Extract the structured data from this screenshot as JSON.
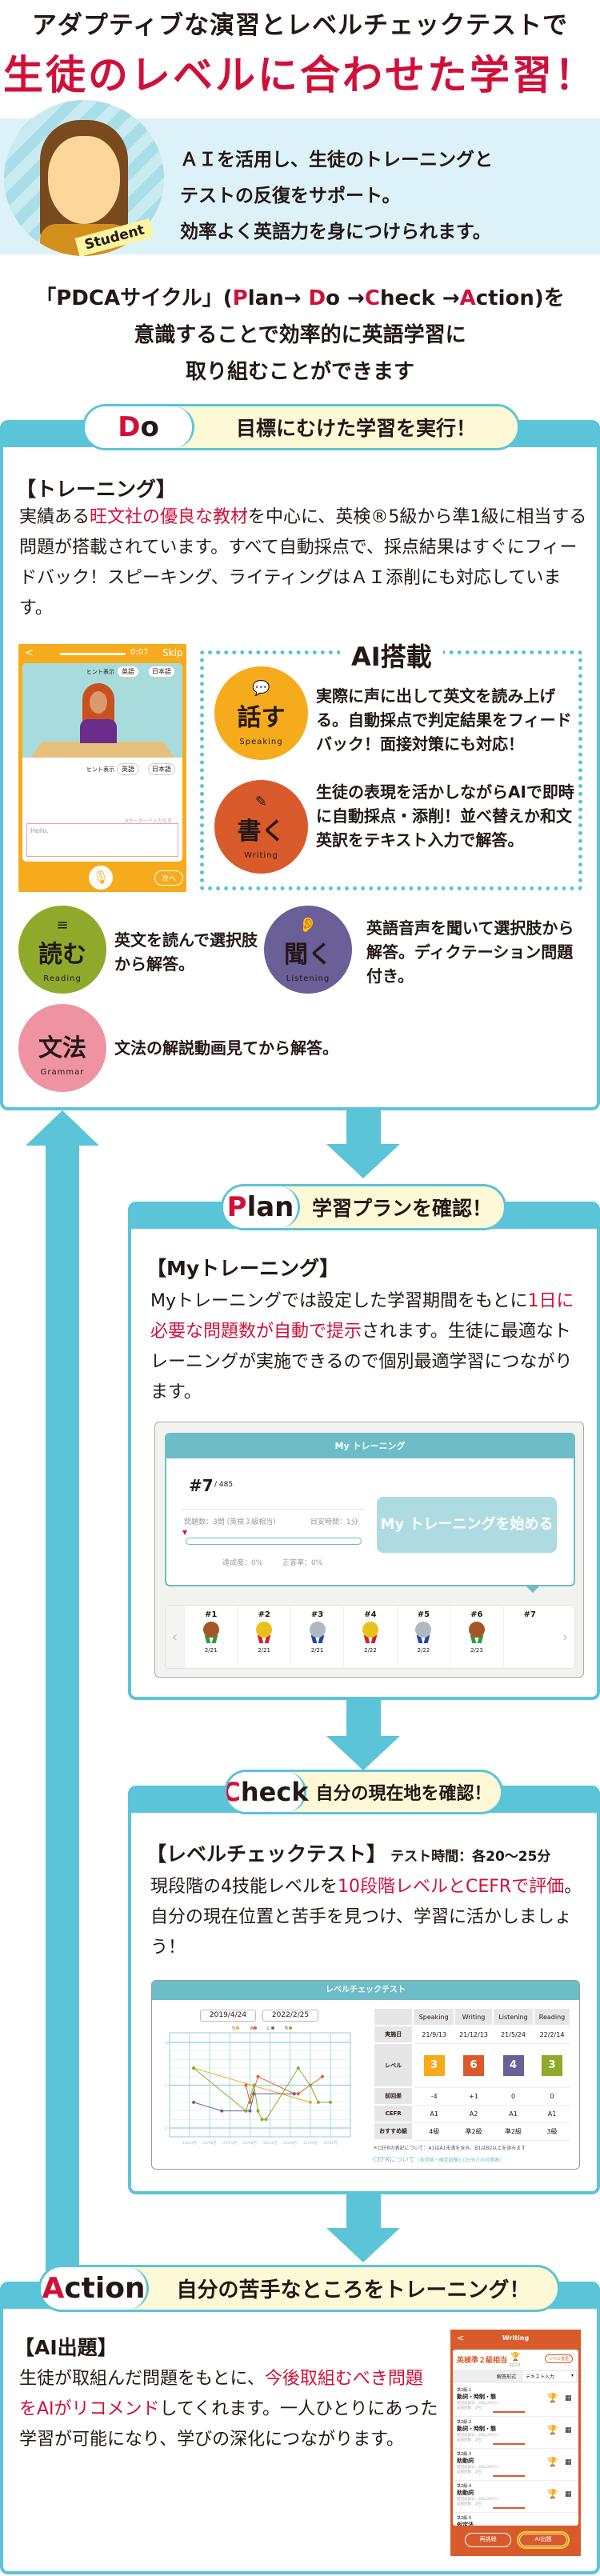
{
  "headline": {
    "line1": "アダプティブな演習とレベルチェックテストで",
    "line2": "生徒のレベルに合わせた学習！"
  },
  "intro": {
    "badge": "Student",
    "lines": [
      "ＡＩを活用し、生徒のトレーニングと",
      "テストの反復をサポート。",
      "効率よく英語力を身につけられます。"
    ]
  },
  "pdca": {
    "open": "「PDCAサイクル」(",
    "p1": "P",
    "p2": "lan→ ",
    "d1": "D",
    "d2": "o →",
    "c1": "C",
    "c2": "heck →",
    "a1": "A",
    "a2": "ction)を",
    "line2": "意識することで効率的に英語学習に",
    "line3": "取り組むことができます"
  },
  "colors": {
    "teal": "#5bc4d8",
    "red": "#d0103a",
    "speaking": "#f5ab1c",
    "writing": "#d95a2b",
    "reading": "#8fa92a",
    "listening": "#6a5f97",
    "grammar": "#ef93a3"
  },
  "do": {
    "key_first": "D",
    "key_rest": "o",
    "title": "目標にむけた学習を実行！",
    "heading": "【トレーニング】",
    "body_a": "実績ある",
    "body_red": "旺文社の優良な教材",
    "body_b": "を中心に、英検®5級から準1級に相当する問題が搭載されています。すべて自動採点で、採点結果はすぐにフィードバック！スピーキング、ライティングはＡＩ添削にも対応しています。",
    "phone": {
      "back": "<",
      "time": "0:07",
      "skip": "Skip",
      "hint": "ヒント表示",
      "en": "英語",
      "ja": "日本語",
      "keyboard_note": "※キーボード入力も可",
      "input": "Hello.",
      "next": "次へ"
    },
    "ai_label": "AI搭載",
    "skills": [
      {
        "name": "話す",
        "en": "Speaking",
        "icon": "speech-bubble-icon",
        "desc": "実際に声に出して英文を読み上げる。自動採点で判定結果をフィードバック！面接対策にも対応！"
      },
      {
        "name": "書く",
        "en": "Writing",
        "icon": "pencil-icon",
        "desc": "生徒の表現を活かしながらAIで即時に自動採点・添削！並べ替えか和文英訳をテキスト入力で解答。"
      },
      {
        "name": "読む",
        "en": "Reading",
        "icon": "text-lines-icon",
        "desc": "英文を読んで選択肢から解答。"
      },
      {
        "name": "聞く",
        "en": "Listening",
        "icon": "ear-icon",
        "desc": "英語音声を聞いて選択肢から解答。ディクテーション問題付き。"
      },
      {
        "name": "文法",
        "en": "Grammar",
        "icon": "",
        "desc": "文法の解説動画見てから解答。"
      }
    ]
  },
  "plan": {
    "key_first": "P",
    "key_rest": "lan",
    "title": "学習プランを確認！",
    "heading": "【Myトレーニング】",
    "body_a": "Myトレーニングでは設定した学習期間をもとに",
    "body_red": "1日に必要な問題数が自動で提示",
    "body_b": "されます。生徒に最適なトレーニングが実施できるので個別最適学習につながります。",
    "mock": {
      "header": "My トレーニング",
      "current": "#7",
      "total": "/ 485",
      "questions": "問題数：3問 (英検３級相当)",
      "time": "目安時間：1分",
      "progress_percent": 0,
      "achievement": "達成度：0%",
      "accuracy": "正答率：0%",
      "start_button": "My トレーニングを始める",
      "sessions": [
        {
          "num": "#1",
          "medal": "bronze",
          "date": "2/21"
        },
        {
          "num": "#2",
          "medal": "gold",
          "date": "2/21"
        },
        {
          "num": "#3",
          "medal": "silver",
          "date": "2/21"
        },
        {
          "num": "#4",
          "medal": "gold",
          "date": "2/22"
        },
        {
          "num": "#5",
          "medal": "silver",
          "date": "2/22"
        },
        {
          "num": "#6",
          "medal": "bronze",
          "date": "2/23"
        },
        {
          "num": "#7",
          "medal": "",
          "date": ""
        }
      ]
    }
  },
  "check": {
    "key_first": "C",
    "key_rest": "heck",
    "title": "自分の現在地を確認！",
    "heading": "【レベルチェックテスト】",
    "subheading": "テスト時間：各20～25分",
    "body_a": "現段階の4技能レベルを",
    "body_red": "10段階レベルとCEFRで評価",
    "body_b": "。自分の現在位置と苦手を見つけ、学習に活かしましょう！",
    "mock": {
      "header": "レベルチェックテスト",
      "date_from": "2019/4/24",
      "date_to": "2022/2/25",
      "table": {
        "columns": [
          "",
          "Speaking",
          "Writing",
          "Listening",
          "Reading"
        ],
        "rows": [
          {
            "label": "実施日",
            "values": [
              "21/9/13",
              "21/12/13",
              "21/5/24",
              "22/2/14"
            ]
          },
          {
            "label": "レベル",
            "values": [
              "3",
              "6",
              "4",
              "3"
            ]
          },
          {
            "label": "前回差",
            "values": [
              "-4",
              "+1",
              "0",
              "0"
            ]
          },
          {
            "label": "CEFR",
            "values": [
              "A1",
              "A2",
              "A1",
              "A1"
            ]
          },
          {
            "label": "おすすめ級",
            "values": [
              "4級",
              "準2級",
              "準2級",
              "3級"
            ]
          }
        ]
      },
      "footnote": "＊CEFRの表記について：A1はA1未満を含み、B1はB2以上を含みます",
      "link": "CEFRについて",
      "link_sub": "（各資格・検定試験とCEFRとの対照表）"
    }
  },
  "chart_data": {
    "type": "line",
    "x_ticks": [
      "19/03月",
      "19/08月",
      "20/01月",
      "20/06月",
      "20/11月",
      "21/04月",
      "21/09月",
      "22/02月"
    ],
    "y_ticks": [
      "0",
      "5",
      "10"
    ],
    "ylim": [
      0,
      10
    ],
    "xlim": [
      "2019-03",
      "2022-02"
    ],
    "grid": true,
    "legend": "top",
    "series": [
      {
        "name": "S",
        "color": "#f5ab1c",
        "points": [
          [
            "2019-04",
            7
          ],
          [
            "2021-09",
            3
          ]
        ]
      },
      {
        "name": "W",
        "color": "#e8602c",
        "points": [
          [
            "2020-05",
            5
          ],
          [
            "2020-06",
            3
          ],
          [
            "2020-08",
            6
          ],
          [
            "2021-05",
            4
          ],
          [
            "2021-06",
            4
          ],
          [
            "2021-09",
            5
          ],
          [
            "2021-12",
            6
          ]
        ]
      },
      {
        "name": "L",
        "color": "#6a5f97",
        "points": [
          [
            "2019-04",
            3
          ],
          [
            "2019-11",
            2
          ],
          [
            "2020-05",
            2
          ],
          [
            "2020-06",
            2
          ],
          [
            "2020-07",
            4
          ],
          [
            "2021-05",
            4
          ]
        ]
      },
      {
        "name": "R",
        "color": "#8fa92a",
        "points": [
          [
            "2019-04",
            7
          ],
          [
            "2020-05",
            2
          ],
          [
            "2020-07",
            5
          ],
          [
            "2020-08",
            2
          ],
          [
            "2020-09",
            1
          ],
          [
            "2020-10",
            1
          ],
          [
            "2021-06",
            7
          ],
          [
            "2021-09",
            5
          ],
          [
            "2021-11",
            3
          ],
          [
            "2022-02",
            3
          ]
        ]
      }
    ]
  },
  "action": {
    "key_first": "A",
    "key_rest": "ction",
    "title": "自分の苦手なところをトレーニング！",
    "heading": "【AI出題】",
    "body_a": "生徒が取組んだ問題をもとに、",
    "body_red": "今後取組むべき問題をAIがリコメンド",
    "body_b": "してくれます。一人ひとりにあった学習が可能になり、学びの深化につながります。",
    "phone": {
      "back": "<",
      "title": "Writing",
      "level": "英検準２級相当",
      "score": "22/22",
      "change_level": "レベル変更",
      "format_label": "解答形式",
      "format_value": "テキスト入力",
      "items": [
        {
          "code": "準2級-1",
          "name": "動詞・時制・態",
          "last": "前回実施日：2021/6/15",
          "count": "実施回数：2回"
        },
        {
          "code": "準2級-2",
          "name": "動詞・時制・態",
          "last": "前回実施日：2021/6/15",
          "count": "実施回数：1回"
        },
        {
          "code": "準2級-3",
          "name": "助動詞",
          "last": "前回実施日：2021/6/15",
          "count": "実施回数：1回"
        },
        {
          "code": "準2級-4",
          "name": "助動詞",
          "last": "前回実施日：2021/6/15",
          "count": "実施回数：1回"
        },
        {
          "code": "準2級-5",
          "name": "仮定法",
          "last": "",
          "count": ""
        }
      ],
      "retry": "再挑戦",
      "ai_button": "AI出題"
    }
  }
}
